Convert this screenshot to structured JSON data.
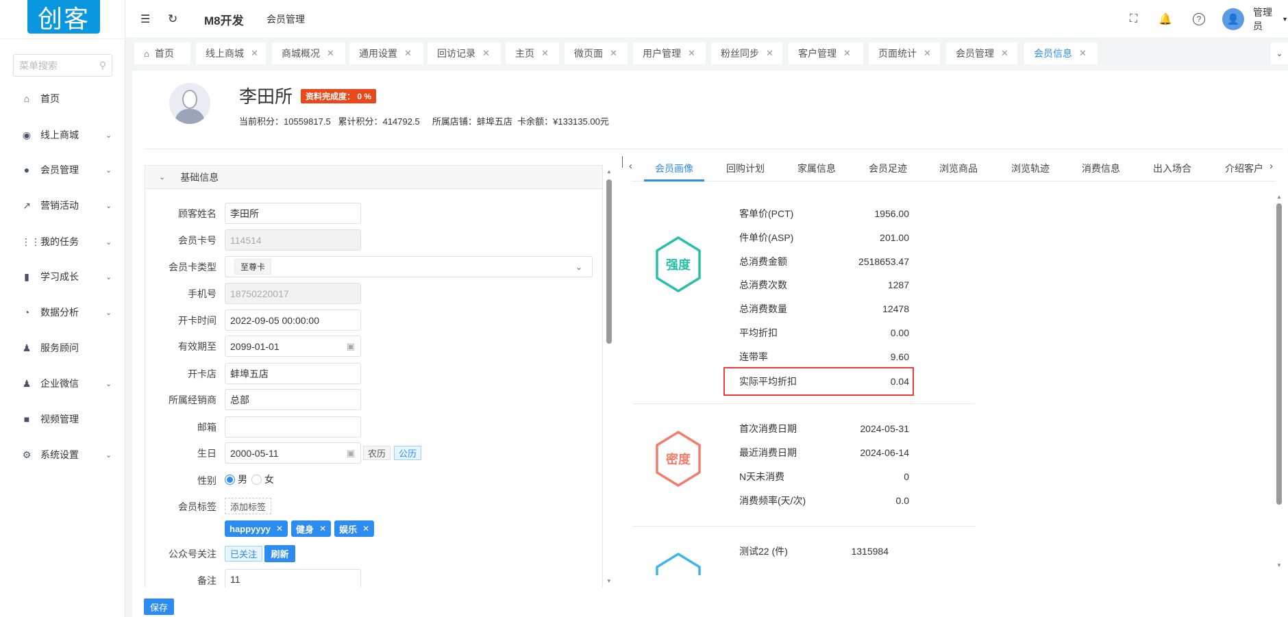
{
  "logo": "创客",
  "sidebar": {
    "search_placeholder": "菜单搜索",
    "items": [
      {
        "label": "首页",
        "icon": "home-icon"
      },
      {
        "label": "线上商城",
        "icon": "mall-icon"
      },
      {
        "label": "会员管理",
        "icon": "user-icon"
      },
      {
        "label": "营销活动",
        "icon": "trend-icon"
      },
      {
        "label": "我的任务",
        "icon": "grid-icon"
      },
      {
        "label": "学习成长",
        "icon": "book-icon"
      },
      {
        "label": "数据分析",
        "icon": "pie-icon"
      },
      {
        "label": "服务顾问",
        "icon": "group-icon"
      },
      {
        "label": "企业微信",
        "icon": "group-icon"
      },
      {
        "label": "视频管理",
        "icon": "video-icon"
      },
      {
        "label": "系统设置",
        "icon": "gear-icon"
      }
    ]
  },
  "header": {
    "title": "M8开发",
    "breadcrumb": "会员管理",
    "user": "管理员"
  },
  "tabs": [
    "首页",
    "线上商城",
    "商城概况",
    "通用设置",
    "回访记录",
    "主页",
    "微页面",
    "用户管理",
    "粉丝同步",
    "客户管理",
    "页面统计",
    "会员管理",
    "会员信息"
  ],
  "profile": {
    "name": "李田所",
    "completeness": "资料完成度： 0 %",
    "points_label": "当前积分：",
    "points": "10559817.5",
    "total_label": "累计积分：",
    "total": "414792.5",
    "store_label": "所属店铺：",
    "store": "蚌埠五店",
    "balance_label": "卡余额：",
    "balance": "¥133135.00元"
  },
  "form": {
    "section": "基础信息",
    "name_label": "顾客姓名",
    "name": "李田所",
    "card_label": "会员卡号",
    "card": "114514",
    "type_label": "会员卡类型",
    "type": "至尊卡",
    "phone_label": "手机号",
    "phone": "18750220017",
    "open_label": "开卡时间",
    "open": "2022-09-05 00:00:00",
    "expire_label": "有效期至",
    "expire": "2099-01-01",
    "store_label": "开卡店",
    "store": "蚌埠五店",
    "dealer_label": "所属经销商",
    "dealer": "总部",
    "email_label": "邮箱",
    "email": "",
    "birthday_label": "生日",
    "birthday": "2000-05-11",
    "lunar": "农历",
    "solar": "公历",
    "gender_label": "性别",
    "male": "男",
    "female": "女",
    "tags_label": "会员标签",
    "add_tag": "添加标签",
    "tags": [
      "happyyyy",
      "健身",
      "娱乐"
    ],
    "wechat_label": "公众号关注",
    "followed": "已关注",
    "refresh": "刷新",
    "remark_label": "备注",
    "remark": "11",
    "save": "保存"
  },
  "right_tabs": [
    "会员画像",
    "回购计划",
    "家属信息",
    "会员足迹",
    "浏览商品",
    "浏览轨迹",
    "消费信息",
    "出入场合",
    "介绍客户"
  ],
  "portrait": {
    "intensity": {
      "title": "强度",
      "color": "#26c0a6",
      "rows": [
        [
          "客单价(PCT)",
          "1956.00"
        ],
        [
          "件单价(ASP)",
          "201.00"
        ],
        [
          "总消费金额",
          "2518653.47"
        ],
        [
          "总消费次数",
          "1287"
        ],
        [
          "总消费数量",
          "12478"
        ],
        [
          "平均折扣",
          "0.00"
        ],
        [
          "连带率",
          "9.60"
        ],
        [
          "实际平均折扣",
          "0.04"
        ]
      ]
    },
    "density": {
      "title": "密度",
      "color": "#f47c6c",
      "rows": [
        [
          "首次消费日期",
          "2024-05-31"
        ],
        [
          "最近消费日期",
          "2024-06-14"
        ],
        [
          "N天未消费",
          "0"
        ],
        [
          "消费频率(天/次)",
          "0.0"
        ]
      ]
    },
    "third": {
      "color": "#3cb4f0",
      "rows": [
        [
          "测试22 (件)",
          "1315984"
        ]
      ]
    }
  }
}
